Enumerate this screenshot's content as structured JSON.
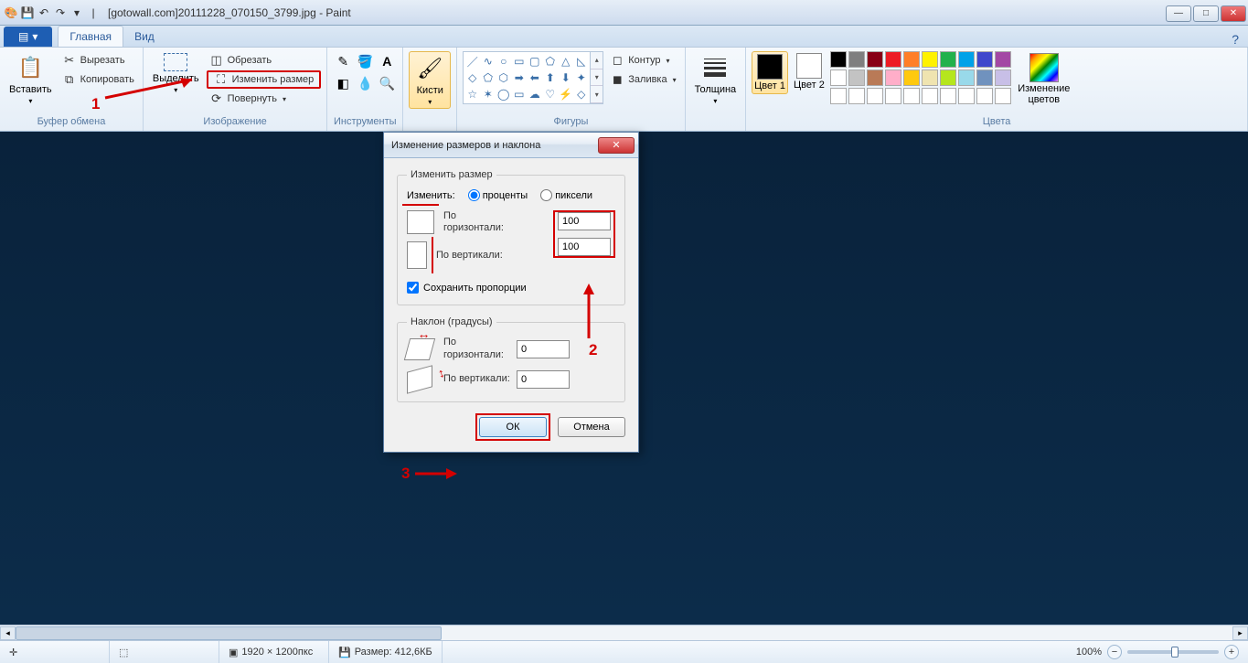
{
  "window": {
    "title": "[gotowall.com]20111228_070150_3799.jpg - Paint"
  },
  "tabs": {
    "file": "",
    "home": "Главная",
    "view": "Вид"
  },
  "ribbon": {
    "clipboard": {
      "paste": "Вставить",
      "cut": "Вырезать",
      "copy": "Копировать",
      "label": "Буфер обмена"
    },
    "image": {
      "select": "Выделить",
      "crop": "Обрезать",
      "resize": "Изменить размер",
      "rotate": "Повернуть",
      "label": "Изображение"
    },
    "tools": {
      "label": "Инструменты"
    },
    "brushes": {
      "label": "Кисти"
    },
    "shapes": {
      "outline": "Контур",
      "fill": "Заливка",
      "label": "Фигуры"
    },
    "thickness": {
      "label": "Толщина"
    },
    "colors": {
      "color1": "Цвет 1",
      "color2": "Цвет 2",
      "edit": "Изменение цветов",
      "label": "Цвета",
      "c1_hex": "#000000",
      "c2_hex": "#ffffff",
      "palette_row1": [
        "#000000",
        "#7f7f7f",
        "#880015",
        "#ed1c24",
        "#ff7f27",
        "#fff200",
        "#22b14c",
        "#00a2e8",
        "#3f48cc",
        "#a349a4"
      ],
      "palette_row2": [
        "#ffffff",
        "#c3c3c3",
        "#b97a57",
        "#ffaec9",
        "#ffc90e",
        "#efe4b0",
        "#b5e61d",
        "#99d9ea",
        "#7092be",
        "#c8bfe7"
      ],
      "palette_row3": [
        "#ffffff",
        "#ffffff",
        "#ffffff",
        "#ffffff",
        "#ffffff",
        "#ffffff",
        "#ffffff",
        "#ffffff",
        "#ffffff",
        "#ffffff"
      ]
    }
  },
  "dialog": {
    "title": "Изменение размеров и наклона",
    "resize_legend": "Изменить размер",
    "change_label": "Изменить:",
    "percent": "проценты",
    "pixels": "пиксели",
    "horizontal": "По горизонтали:",
    "vertical": "По вертикали:",
    "h_value": "100",
    "v_value": "100",
    "keep_ratio": "Сохранить пропорции",
    "skew_legend": "Наклон (градусы)",
    "skew_h": "0",
    "skew_v": "0",
    "ok": "ОК",
    "cancel": "Отмена"
  },
  "status": {
    "dims": "1920 × 1200пкс",
    "size": "Размер: 412,6КБ",
    "zoom": "100%"
  },
  "annotations": {
    "n1": "1",
    "n2": "2",
    "n3": "3"
  }
}
